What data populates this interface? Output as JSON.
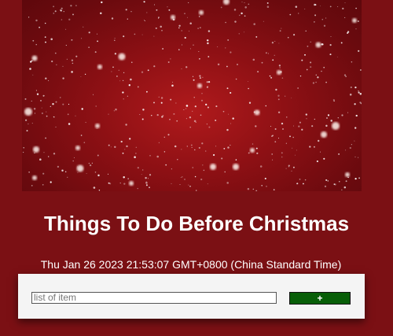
{
  "page": {
    "title": "Things To Do Before Christmas",
    "datetime": "Thu Jan 26 2023 21:53:07 GMT+0800 (China Standard Time)"
  },
  "hero": {
    "image": "snow-falling-on-red-background"
  },
  "todo_form": {
    "input_value": "",
    "input_placeholder": "list of item",
    "add_button_label": "+"
  },
  "colors": {
    "page_background": "#7b1014",
    "card_background": "#f4f4f4",
    "add_button": "#075e07",
    "text": "#ffffff"
  }
}
